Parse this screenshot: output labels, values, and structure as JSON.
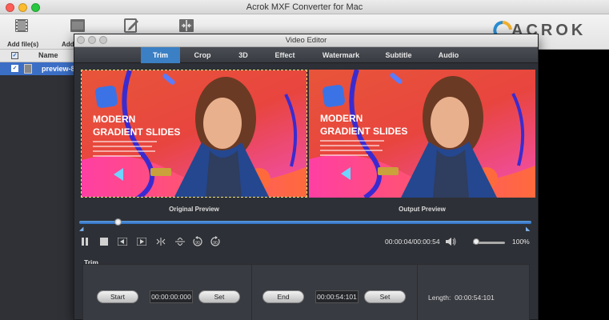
{
  "app": {
    "title": "Acrok MXF Converter for Mac",
    "logo_text": "ACROK",
    "toolbar": [
      {
        "label": "Add file(s)",
        "icon": "add-file-icon"
      },
      {
        "label": "Add",
        "icon": "folder-icon"
      },
      {
        "label": "",
        "icon": "edit-icon"
      },
      {
        "label": "",
        "icon": "merge-icon"
      }
    ]
  },
  "file_list": {
    "column_name": "Name",
    "rows": [
      {
        "name": "preview-8",
        "checked": true
      }
    ]
  },
  "editor": {
    "title": "Video Editor",
    "tabs": [
      "Trim",
      "Crop",
      "3D",
      "Effect",
      "Watermark",
      "Subtitle",
      "Audio"
    ],
    "active_tab": "Trim",
    "preview": {
      "headline_1": "MODERN",
      "headline_2": "GRADIENT SLIDES",
      "original_label": "Original Preview",
      "output_label": "Output Preview"
    },
    "playback": {
      "position_fraction": 0.085,
      "current_time": "00:00:04",
      "total_time": "00:00:54",
      "volume_fraction": 0.1,
      "zoom": "100%"
    },
    "trim": {
      "section_label": "Trim",
      "start_button": "Start",
      "start_time": "00:00:00:000",
      "set_button": "Set",
      "end_button": "End",
      "end_time": "00:00:54:101",
      "length_label": "Length:",
      "length_value": "00:00:54:101"
    }
  },
  "colors": {
    "accent": "#3b7fc4",
    "brand": "#2a8fd6"
  }
}
